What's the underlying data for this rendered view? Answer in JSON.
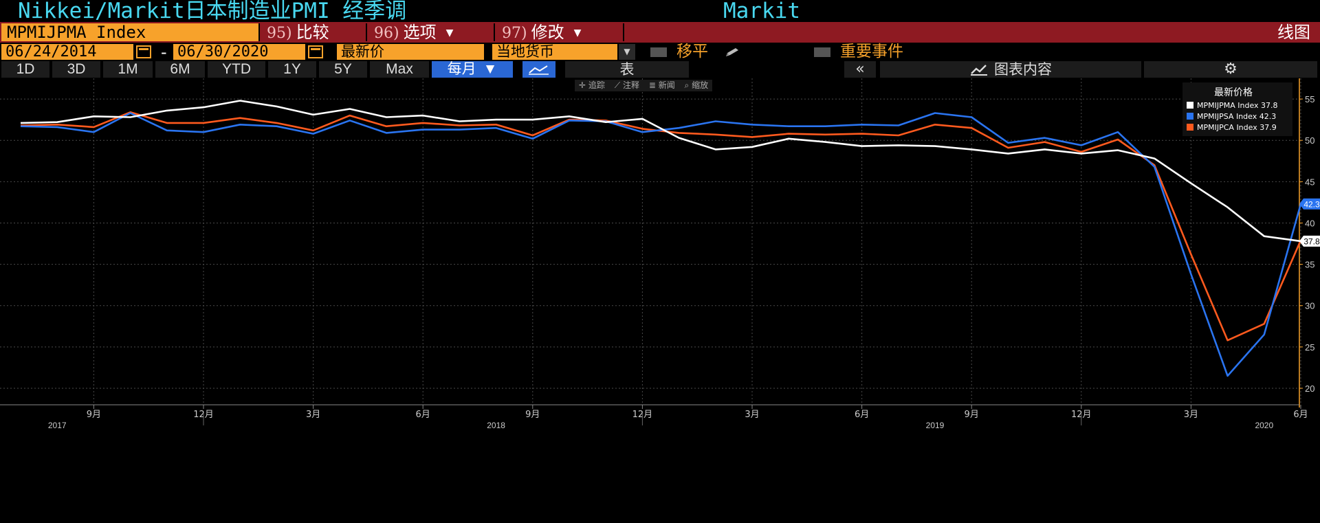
{
  "title": {
    "text": "Nikkei/Markit日本制造业PMI 经季调",
    "source": "Markit"
  },
  "command_bar": {
    "ticker": "MPMIJPMA Index",
    "compare": {
      "num": "95)",
      "label": "比较"
    },
    "options": {
      "num": "96)",
      "label": "选项"
    },
    "edit": {
      "num": "97)",
      "label": "修改"
    },
    "chart_kind": "线图"
  },
  "options_bar": {
    "start_date": "06/24/2014",
    "dash": "-",
    "end_date": "06/30/2020",
    "price_field": "最新价",
    "currency": "当地货币",
    "moving_avg": "移平",
    "key_events": "重要事件"
  },
  "period_bar": {
    "periods": [
      "1D",
      "3D",
      "1M",
      "6M",
      "YTD",
      "1Y",
      "5Y",
      "Max"
    ],
    "frequency": "每月",
    "table_label": "表",
    "collapse": "«",
    "chart_content": "图表内容"
  },
  "mini_toolbar": {
    "track": "追踪",
    "annotate": "注释",
    "news": "新闻",
    "zoom": "缩放"
  },
  "legend": {
    "title": "最新价格"
  },
  "colors": {
    "accent": "#f7a22b",
    "command_bar_bg": "#8e1a22",
    "title_text": "#49d8f0",
    "active_tab": "#2a67d4"
  },
  "chart_data": {
    "type": "line",
    "x": [
      "2017-07",
      "2017-08",
      "2017-09",
      "2017-10",
      "2017-11",
      "2017-12",
      "2018-01",
      "2018-02",
      "2018-03",
      "2018-04",
      "2018-05",
      "2018-06",
      "2018-07",
      "2018-08",
      "2018-09",
      "2018-10",
      "2018-11",
      "2018-12",
      "2019-01",
      "2019-02",
      "2019-03",
      "2019-04",
      "2019-05",
      "2019-06",
      "2019-07",
      "2019-08",
      "2019-09",
      "2019-10",
      "2019-11",
      "2019-12",
      "2020-01",
      "2020-02",
      "2020-03",
      "2020-04",
      "2020-05",
      "2020-06"
    ],
    "series": [
      {
        "name": "MPMIJPMA Index",
        "last": "37.8",
        "color": "#ffffff",
        "values": [
          52.1,
          52.2,
          52.9,
          52.8,
          53.6,
          54.0,
          54.8,
          54.1,
          53.1,
          53.8,
          52.8,
          53.0,
          52.3,
          52.5,
          52.5,
          52.9,
          52.2,
          52.6,
          50.3,
          48.9,
          49.2,
          50.2,
          49.8,
          49.3,
          49.4,
          49.3,
          48.9,
          48.4,
          48.9,
          48.4,
          48.8,
          47.8,
          44.8,
          41.9,
          38.4,
          37.8
        ]
      },
      {
        "name": "MPMIJPSA Index",
        "last": "42.3",
        "color": "#2a74f0",
        "values": [
          51.7,
          51.6,
          51.0,
          53.3,
          51.2,
          51.0,
          51.9,
          51.7,
          50.8,
          52.4,
          50.9,
          51.3,
          51.3,
          51.5,
          50.2,
          52.4,
          52.3,
          51.0,
          51.5,
          52.3,
          51.9,
          51.7,
          51.7,
          51.9,
          51.8,
          53.3,
          52.8,
          49.7,
          50.3,
          49.4,
          51.0,
          46.8,
          33.8,
          21.5,
          26.5,
          42.3
        ]
      },
      {
        "name": "MPMIJPCA Index",
        "last": "37.9",
        "color": "#ff5a1e",
        "values": [
          51.8,
          51.9,
          51.6,
          53.4,
          52.1,
          52.1,
          52.7,
          52.1,
          51.2,
          53.0,
          51.7,
          52.1,
          51.8,
          51.9,
          50.6,
          52.5,
          52.4,
          51.4,
          50.9,
          50.7,
          50.4,
          50.8,
          50.7,
          50.8,
          50.6,
          51.9,
          51.5,
          49.1,
          49.8,
          48.6,
          50.1,
          47.0,
          36.2,
          25.8,
          27.8,
          37.9
        ]
      }
    ],
    "y_ticks": [
      20,
      25,
      30,
      35,
      40,
      45,
      50,
      55
    ],
    "ylim": [
      18,
      57.5
    ],
    "x_tick_labels": [
      {
        "i": 2,
        "label": "9月"
      },
      {
        "i": 5,
        "label": "12月"
      },
      {
        "i": 8,
        "label": "3月"
      },
      {
        "i": 11,
        "label": "6月"
      },
      {
        "i": 14,
        "label": "9月"
      },
      {
        "i": 17,
        "label": "12月"
      },
      {
        "i": 20,
        "label": "3月"
      },
      {
        "i": 23,
        "label": "6月"
      },
      {
        "i": 26,
        "label": "9月"
      },
      {
        "i": 29,
        "label": "12月"
      },
      {
        "i": 32,
        "label": "3月"
      },
      {
        "i": 35,
        "label": "6月"
      }
    ],
    "year_labels": [
      {
        "i": 1,
        "label": "2017"
      },
      {
        "i": 13,
        "label": "2018"
      },
      {
        "i": 25,
        "label": "2019"
      },
      {
        "i": 34,
        "label": "2020"
      }
    ],
    "grid": true,
    "legend_position": "top-right"
  }
}
